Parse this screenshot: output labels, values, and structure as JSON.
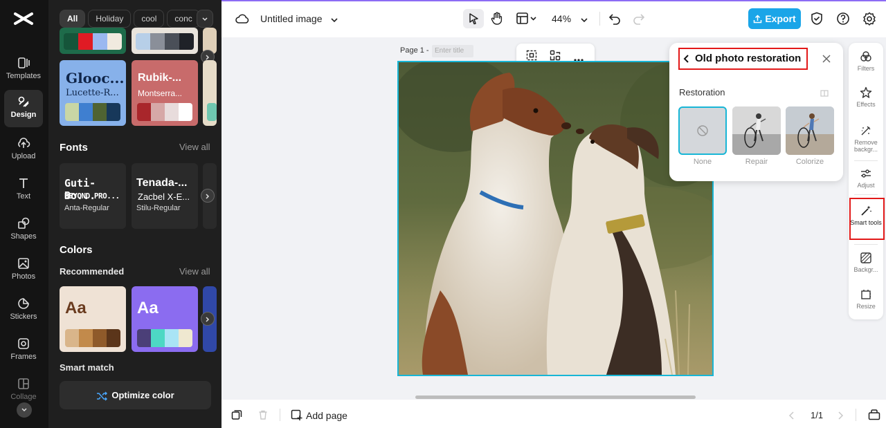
{
  "rail": {
    "items": [
      {
        "label": "Templates"
      },
      {
        "label": "Design"
      },
      {
        "label": "Upload"
      },
      {
        "label": "Text"
      },
      {
        "label": "Shapes"
      },
      {
        "label": "Photos"
      },
      {
        "label": "Stickers"
      },
      {
        "label": "Frames"
      },
      {
        "label": "Collage"
      }
    ]
  },
  "panel": {
    "chips": [
      "All",
      "Holiday",
      "cool",
      "conc"
    ],
    "font_pairs": [
      {
        "title": "Glooc...",
        "subtitle": "Lucette-R...",
        "colors": [
          "#c9d6a5",
          "#3f7fd0",
          "#4f6332",
          "#17385a"
        ],
        "bg": "#87b1ea"
      },
      {
        "title": "Rubik-...",
        "subtitle": "Montserra...",
        "colors": [
          "#a9262b",
          "#d6a8a7",
          "#e8dcdc",
          "#ffffff"
        ],
        "bg": "#c86b6b"
      }
    ],
    "fonts_title": "Fonts",
    "fonts_view_all": "View all",
    "fonts": [
      {
        "line1": "Guti-Bo...",
        "line2": "BEYOND PRO...",
        "line3": "Anta-Regular"
      },
      {
        "line1": "Tenada-...",
        "line2": "Zacbel X-E...",
        "line3": "Stilu-Regular"
      }
    ],
    "colors_title": "Colors",
    "recommended_label": "Recommended",
    "colors_view_all": "View all",
    "palettes": [
      {
        "sample": "Aa",
        "bg": "#efe2d5",
        "text_color": "#6a3b1f",
        "colors": [
          "#d9b58a",
          "#c28a4b",
          "#8f5a2a",
          "#5b351a"
        ]
      },
      {
        "sample": "Aa",
        "bg": "#8b6cf0",
        "text_color": "#ffffff",
        "colors": [
          "#4b3f78",
          "#4dd8c4",
          "#a9e4f5",
          "#efe8d0"
        ]
      }
    ],
    "smart_match_label": "Smart match",
    "optimize_label": "Optimize color"
  },
  "topbar": {
    "doc_title": "Untitled image",
    "zoom": "44%",
    "export_label": "Export"
  },
  "canvas": {
    "page_label": "Page 1 -",
    "title_placeholder": "Enter title"
  },
  "popover": {
    "title": "Old photo restoration",
    "section": "Restoration",
    "options": [
      {
        "label": "None"
      },
      {
        "label": "Repair"
      },
      {
        "label": "Colorize"
      }
    ]
  },
  "right_tools": [
    {
      "label": "Filters"
    },
    {
      "label": "Effects"
    },
    {
      "label": "Remove backgr..."
    },
    {
      "label": "Adjust"
    },
    {
      "label": "Smart tools"
    },
    {
      "label": "Backgr..."
    },
    {
      "label": "Resize"
    }
  ],
  "bottombar": {
    "add_page_label": "Add page",
    "page_count": "1/1"
  },
  "colors": {
    "accent": "#1aa5e8",
    "selection": "#17b6d6",
    "highlight": "#e21818"
  }
}
